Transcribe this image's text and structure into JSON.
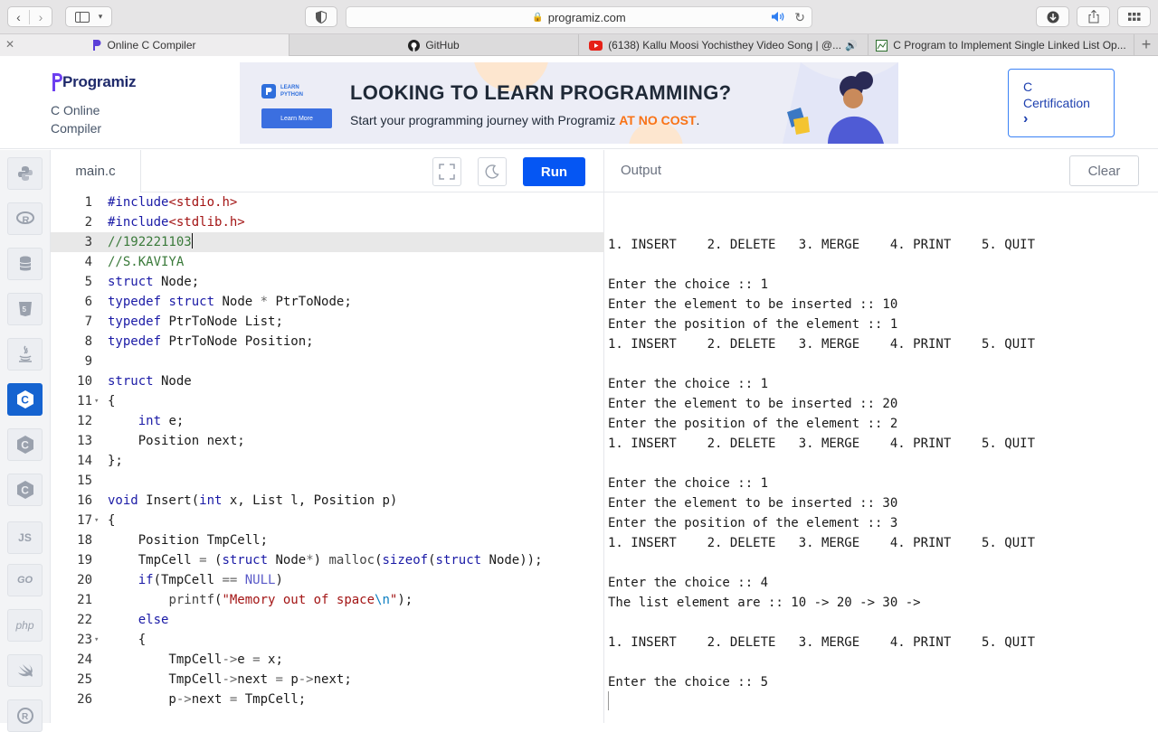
{
  "browser": {
    "url": "programiz.com",
    "tabs": [
      {
        "title": "Online C Compiler",
        "active": true
      },
      {
        "title": "GitHub",
        "active": false
      },
      {
        "title": "(6138) Kallu Moosi Yochisthey Video Song | @...",
        "active": false
      },
      {
        "title": "C Program to Implement Single Linked List Op...",
        "active": false
      }
    ]
  },
  "header": {
    "logo": "Programiz",
    "subtitle": "C Online Compiler",
    "ad": {
      "badge_line1": "LEARN",
      "badge_line2": "PYTHON",
      "button": "Learn More",
      "title": "LOOKING TO LEARN PROGRAMMING?",
      "subtitle_prefix": "Start your programming journey with Programiz ",
      "subtitle_highlight": "AT NO COST",
      "subtitle_suffix": "."
    },
    "cert_line1": "C",
    "cert_line2": "Certification",
    "cert_arrow": "›"
  },
  "sidebar": {
    "languages": [
      "python",
      "r",
      "sql",
      "html",
      "java",
      "c",
      "cpp",
      "csharp",
      "js",
      "go",
      "php",
      "swift",
      "rust"
    ],
    "active": "c",
    "js_label": "JS",
    "go_label": "GO",
    "php_label": "php"
  },
  "editor": {
    "filename": "main.c",
    "run_label": "Run",
    "current_line": 3,
    "lines": [
      {
        "n": "1",
        "text": "#include<stdio.h>"
      },
      {
        "n": "2",
        "text": "#include<stdlib.h>"
      },
      {
        "n": "3",
        "text": "//192221103"
      },
      {
        "n": "4",
        "text": "//S.KAVIYA"
      },
      {
        "n": "5",
        "text": "struct Node;"
      },
      {
        "n": "6",
        "text": "typedef struct Node * PtrToNode;"
      },
      {
        "n": "7",
        "text": "typedef PtrToNode List;"
      },
      {
        "n": "8",
        "text": "typedef PtrToNode Position;"
      },
      {
        "n": "9",
        "text": ""
      },
      {
        "n": "10",
        "text": "struct Node"
      },
      {
        "n": "11",
        "text": "{",
        "fold": true
      },
      {
        "n": "12",
        "text": "    int e;"
      },
      {
        "n": "13",
        "text": "    Position next;"
      },
      {
        "n": "14",
        "text": "};"
      },
      {
        "n": "15",
        "text": ""
      },
      {
        "n": "16",
        "text": "void Insert(int x, List l, Position p)"
      },
      {
        "n": "17",
        "text": "{",
        "fold": true
      },
      {
        "n": "18",
        "text": "    Position TmpCell;"
      },
      {
        "n": "19",
        "text": "    TmpCell = (struct Node*) malloc(sizeof(struct Node));"
      },
      {
        "n": "20",
        "text": "    if(TmpCell == NULL)"
      },
      {
        "n": "21",
        "text": "        printf(\"Memory out of space\\n\");"
      },
      {
        "n": "22",
        "text": "    else"
      },
      {
        "n": "23",
        "text": "    {",
        "fold": true
      },
      {
        "n": "24",
        "text": "        TmpCell->e = x;"
      },
      {
        "n": "25",
        "text": "        TmpCell->next = p->next;"
      },
      {
        "n": "26",
        "text": "        p->next = TmpCell;"
      }
    ]
  },
  "output": {
    "title": "Output",
    "clear_label": "Clear",
    "lines": [
      "1. INSERT    2. DELETE   3. MERGE    4. PRINT    5. QUIT",
      "",
      "Enter the choice :: 1",
      "Enter the element to be inserted :: 10",
      "Enter the position of the element :: 1",
      "1. INSERT    2. DELETE   3. MERGE    4. PRINT    5. QUIT",
      "",
      "Enter the choice :: 1",
      "Enter the element to be inserted :: 20",
      "Enter the position of the element :: 2",
      "1. INSERT    2. DELETE   3. MERGE    4. PRINT    5. QUIT",
      "",
      "Enter the choice :: 1",
      "Enter the element to be inserted :: 30",
      "Enter the position of the element :: 3",
      "1. INSERT    2. DELETE   3. MERGE    4. PRINT    5. QUIT",
      "",
      "Enter the choice :: 4",
      "The list element are :: 10 -> 20 -> 30 ->",
      "",
      "1. INSERT    2. DELETE   3. MERGE    4. PRINT    5. QUIT",
      "",
      "Enter the choice :: 5"
    ]
  },
  "colors": {
    "accent": "#0556f3",
    "keyword": "#1a1aa6",
    "string": "#a31515",
    "comment": "#3a7a3a",
    "brand": "#1f2a6b",
    "highlight": "#f97316"
  }
}
